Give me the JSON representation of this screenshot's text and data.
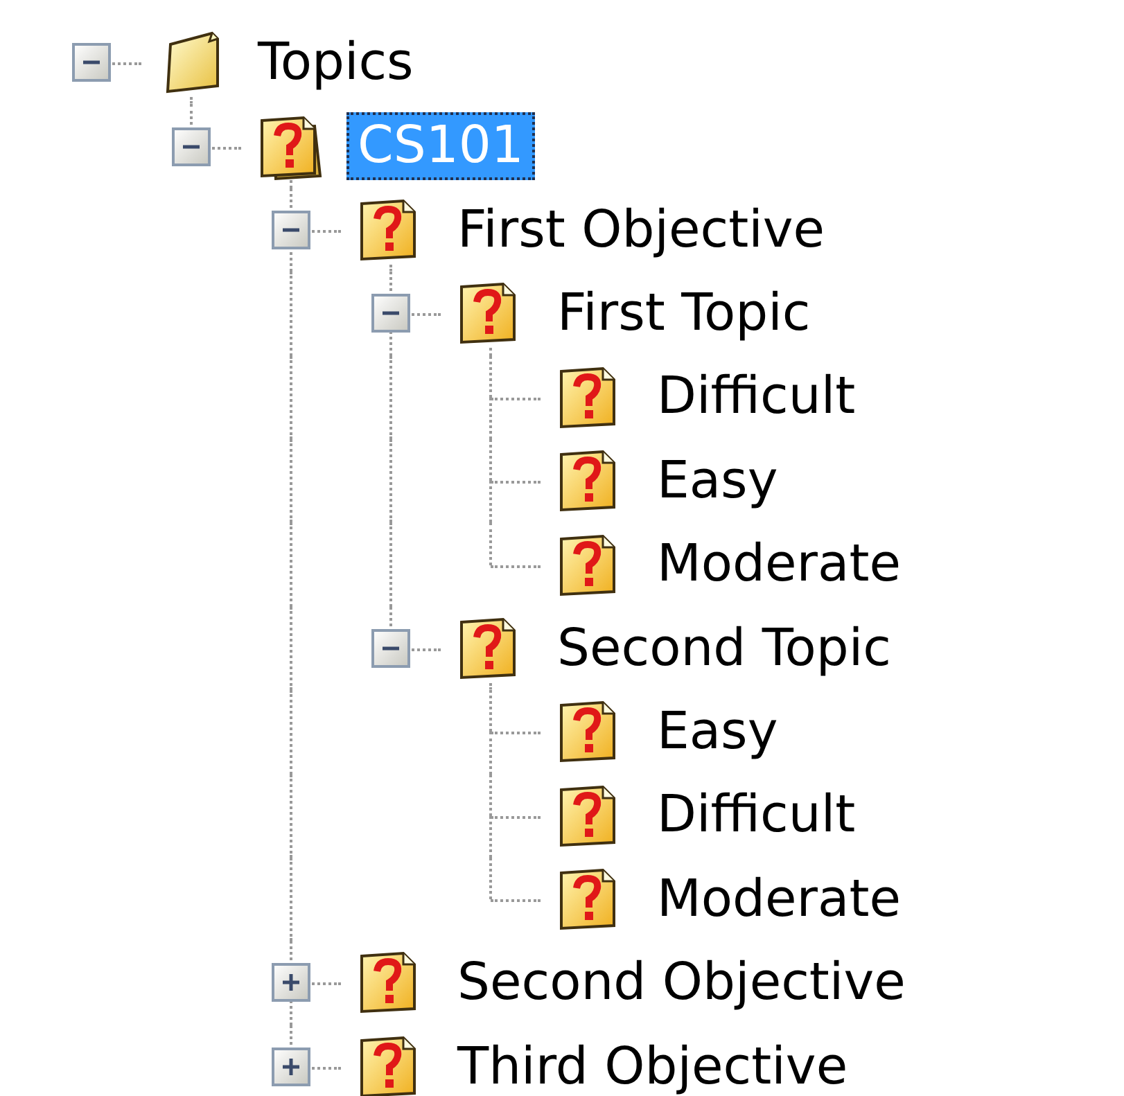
{
  "tree": [
    {
      "label": "Topics",
      "kind": "folder",
      "selected": false,
      "expanded": true,
      "children": [
        {
          "label": "CS101",
          "kind": "stack",
          "selected": true,
          "expanded": true,
          "children": [
            {
              "label": "First Objective",
              "kind": "page",
              "selected": false,
              "expanded": true,
              "children": [
                {
                  "label": "First Topic",
                  "kind": "page",
                  "selected": false,
                  "expanded": true,
                  "children": [
                    {
                      "label": "Difficult",
                      "kind": "page",
                      "selected": false
                    },
                    {
                      "label": "Easy",
                      "kind": "page",
                      "selected": false
                    },
                    {
                      "label": "Moderate",
                      "kind": "page",
                      "selected": false
                    }
                  ]
                },
                {
                  "label": "Second Topic",
                  "kind": "page",
                  "selected": false,
                  "expanded": true,
                  "children": [
                    {
                      "label": "Easy",
                      "kind": "page",
                      "selected": false
                    },
                    {
                      "label": "Difficult",
                      "kind": "page",
                      "selected": false
                    },
                    {
                      "label": "Moderate",
                      "kind": "page",
                      "selected": false
                    }
                  ]
                }
              ]
            },
            {
              "label": "Second Objective",
              "kind": "page",
              "selected": false,
              "expanded": false
            },
            {
              "label": "Third Objective",
              "kind": "page",
              "selected": false,
              "expanded": false
            }
          ]
        }
      ]
    }
  ]
}
